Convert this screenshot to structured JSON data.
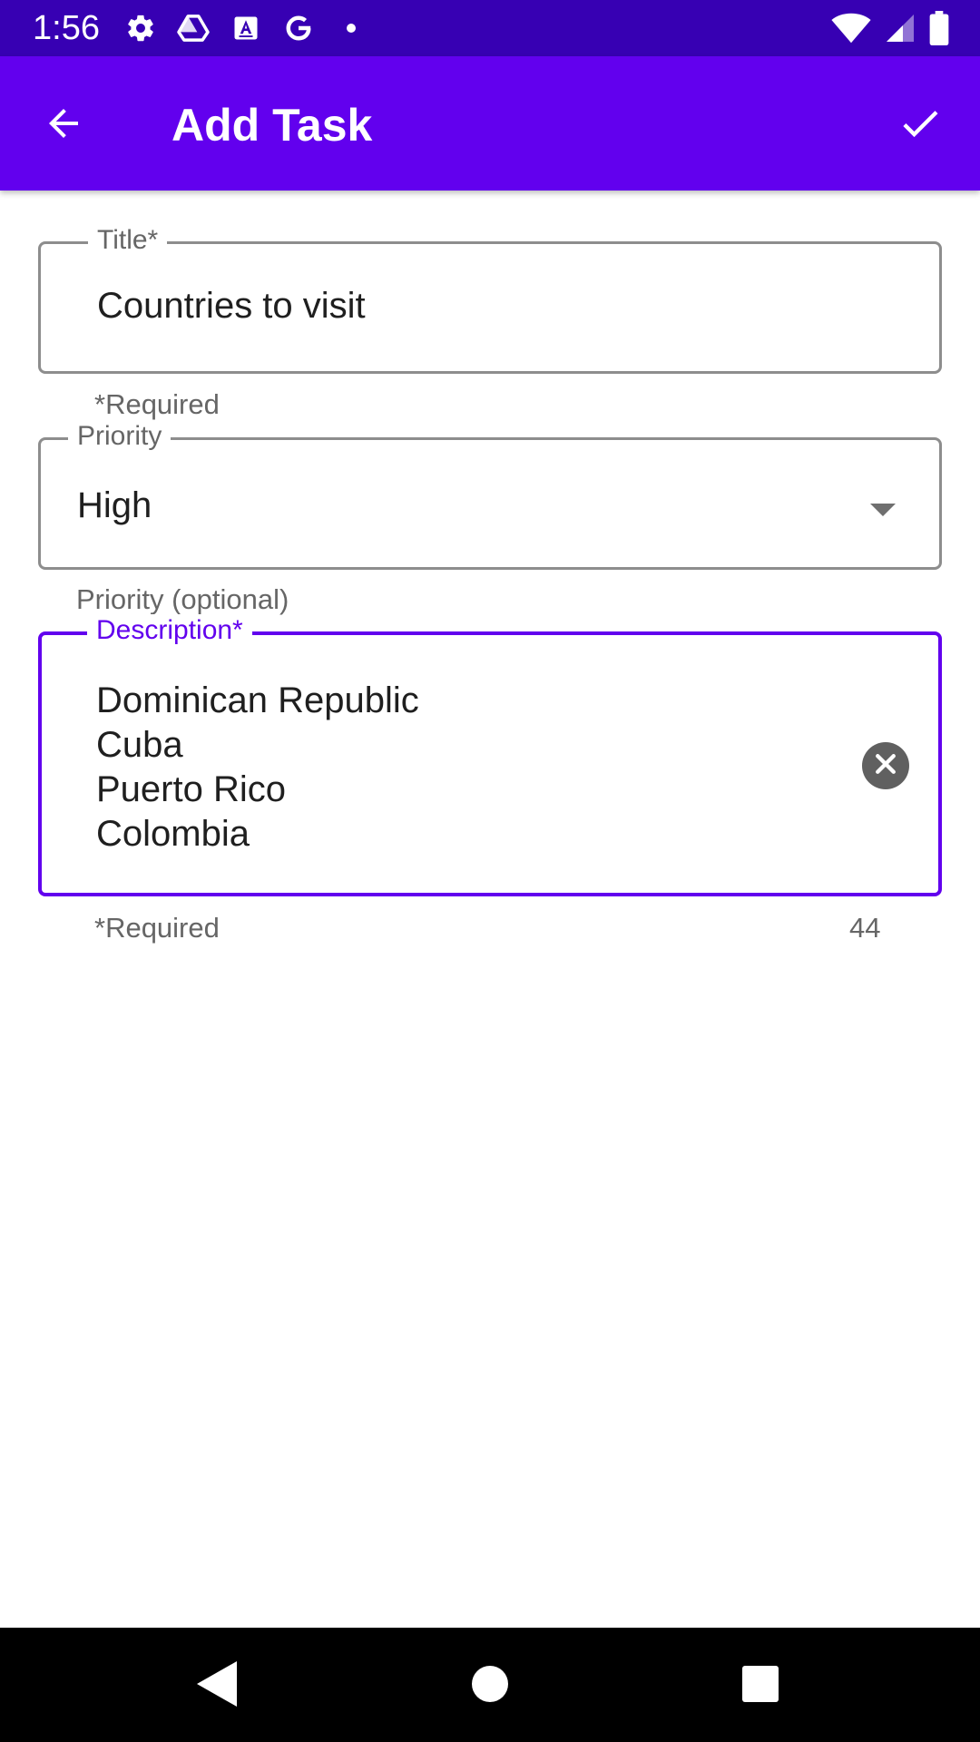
{
  "status_bar": {
    "time": "1:56",
    "left_icons": [
      "settings-icon",
      "drive-icon",
      "font-icon",
      "google-icon",
      "dot-icon"
    ],
    "right_icons": [
      "wifi-icon",
      "signal-icon",
      "battery-icon"
    ]
  },
  "app_bar": {
    "title": "Add Task",
    "back_icon": "arrow-back-icon",
    "save_icon": "check-icon",
    "color": "#6200ee"
  },
  "form": {
    "title_field": {
      "label": "Title*",
      "value": "Countries to visit",
      "helper": "*Required"
    },
    "priority_field": {
      "label": "Priority",
      "value": "High",
      "helper": "Priority (optional)"
    },
    "description_field": {
      "label": "Description*",
      "value": "Dominican Republic\nCuba\nPuerto Rico\nColombia",
      "helper": "*Required",
      "counter": "44",
      "focused": true
    }
  },
  "nav_bar": {
    "buttons": [
      "back-triangle-icon",
      "home-circle-icon",
      "recents-square-icon"
    ]
  },
  "colors": {
    "status_bar": "#3700b3",
    "accent": "#6200ee",
    "outline": "#8d8d8d"
  }
}
